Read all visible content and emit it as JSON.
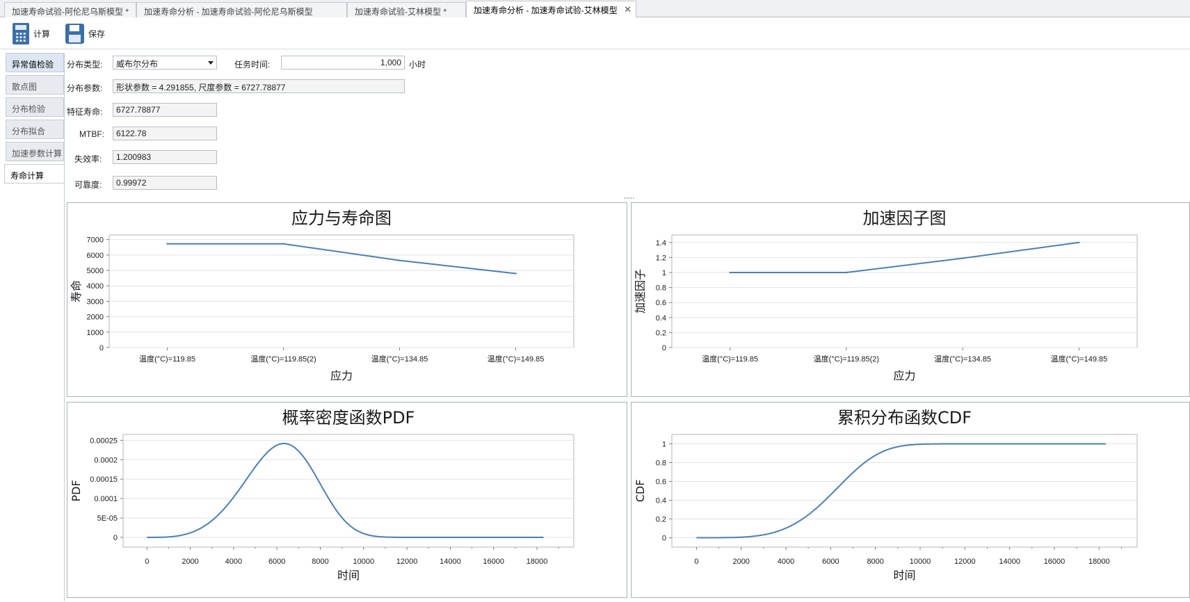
{
  "tabs": [
    {
      "label": "加速寿命试验-阿伦尼乌斯模型 *"
    },
    {
      "label": "加速寿命分析 - 加速寿命试验-阿伦尼乌斯模型"
    },
    {
      "label": "加速寿命试验-艾林模型 *"
    },
    {
      "label": "加速寿命分析 - 加速寿命试验-艾林模型",
      "close": "✕"
    }
  ],
  "toolbar": {
    "calc_label": "计算",
    "save_label": "保存"
  },
  "sidebar": {
    "items": [
      {
        "label": "异常值检验"
      },
      {
        "label": "散点图"
      },
      {
        "label": "分布检验"
      },
      {
        "label": "分布拟合"
      },
      {
        "label": "加速参数计算"
      },
      {
        "label": "寿命计算"
      }
    ]
  },
  "form": {
    "dist_type_label": "分布类型:",
    "dist_type_value": "威布尔分布",
    "mission_time_label": "任务时间:",
    "mission_time_value": "1,000",
    "mission_time_unit": "小时",
    "params_label": "分布参数:",
    "params_value": "形状参数 = 4.291855, 尺度参数 = 6727.78877",
    "char_life_label": "特征寿命:",
    "char_life_value": "6727.78877",
    "mtbf_label": "MTBF:",
    "mtbf_value": "6122.78",
    "failure_rate_label": "失效率:",
    "failure_rate_value": "1.200983",
    "reliability_label": "可靠度:",
    "reliability_value": "0.99972"
  },
  "colors": {
    "series": "#4a7ebb",
    "grid": "#e2e2e2"
  },
  "chart_data": [
    {
      "type": "line",
      "title": "应力与寿命图",
      "xlabel": "应力",
      "ylabel": "寿命",
      "categories": [
        "温度(°C)=119.85",
        "温度(°C)=119.85(2)",
        "温度(°C)=134.85",
        "温度(°C)=149.85"
      ],
      "values": [
        6728,
        6728,
        5650,
        4800
      ],
      "ylim": [
        0,
        7300
      ],
      "yticks": [
        "0",
        "1000",
        "2000",
        "3000",
        "4000",
        "5000",
        "6000",
        "7000"
      ],
      "ytick_values": [
        0,
        1000,
        2000,
        3000,
        4000,
        5000,
        6000,
        7000
      ]
    },
    {
      "type": "line",
      "title": "加速因子图",
      "xlabel": "应力",
      "ylabel": "加速因子",
      "categories": [
        "温度(°C)=119.85",
        "温度(°C)=119.85(2)",
        "温度(°C)=134.85",
        "温度(°C)=149.85"
      ],
      "values": [
        1,
        1,
        1.19,
        1.4
      ],
      "ylim": [
        0,
        1.5
      ],
      "yticks": [
        "0",
        "0.2",
        "0.4",
        "0.6",
        "0.8",
        "1",
        "1.2",
        "1.4"
      ],
      "ytick_values": [
        0,
        0.2,
        0.4,
        0.6,
        0.8,
        1.0,
        1.2,
        1.4
      ]
    },
    {
      "type": "line",
      "title": "概率密度函数PDF",
      "xlabel": "时间",
      "ylabel": "PDF",
      "function": "weibull_pdf",
      "shape": 4.291855,
      "scale": 6727.78877,
      "x_range": [
        0,
        18300
      ],
      "xlim": [
        -1100,
        19700
      ],
      "ylim": [
        -2.5e-05,
        0.000265
      ],
      "xticks": [
        "0",
        "2000",
        "4000",
        "6000",
        "8000",
        "10000",
        "12000",
        "14000",
        "16000",
        "18000"
      ],
      "xtick_values": [
        0,
        2000,
        4000,
        6000,
        8000,
        10000,
        12000,
        14000,
        16000,
        18000
      ],
      "yticks": [
        "0",
        "5E-05",
        "0.0001",
        "0.00015",
        "0.0002",
        "0.00025"
      ],
      "ytick_values": [
        0,
        5e-05,
        0.0001,
        0.00015,
        0.0002,
        0.00025
      ]
    },
    {
      "type": "line",
      "title": "累积分布函数CDF",
      "xlabel": "时间",
      "ylabel": "CDF",
      "function": "weibull_cdf",
      "shape": 4.291855,
      "scale": 6727.78877,
      "x_range": [
        0,
        18300
      ],
      "xlim": [
        -1100,
        19700
      ],
      "ylim": [
        -0.1,
        1.1
      ],
      "xticks": [
        "0",
        "2000",
        "4000",
        "6000",
        "8000",
        "10000",
        "12000",
        "14000",
        "16000",
        "18000"
      ],
      "xtick_values": [
        0,
        2000,
        4000,
        6000,
        8000,
        10000,
        12000,
        14000,
        16000,
        18000
      ],
      "yticks": [
        "0",
        "0.2",
        "0.4",
        "0.6",
        "0.8",
        "1"
      ],
      "ytick_values": [
        0,
        0.2,
        0.4,
        0.6,
        0.8,
        1.0
      ]
    }
  ]
}
